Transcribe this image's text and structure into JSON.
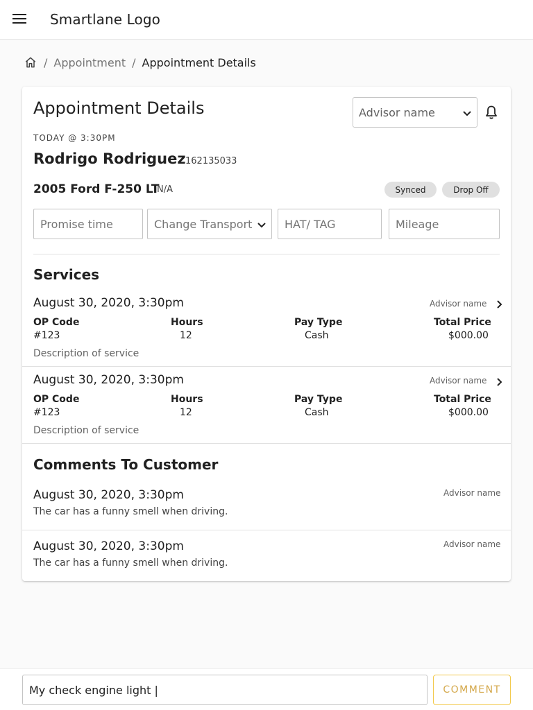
{
  "header": {
    "logo_text": "Smartlane Logo"
  },
  "breadcrumb": {
    "sep1": "/",
    "link": "Appointment",
    "sep2": "/",
    "current": "Appointment Details"
  },
  "details": {
    "title": "Appointment Details",
    "advisor_select": "Advisor name",
    "time_label": "TODAY @ 3:30PM",
    "customer_name": "Rodrigo Rodriguez",
    "customer_id": "162135033",
    "vehicle": "2005 Ford F-250 LT",
    "vehicle_sub": "N/A",
    "chips": {
      "synced": "Synced",
      "drop_off": "Drop Off"
    },
    "fields": {
      "promise": "Promise time",
      "transport": "Change Transport",
      "hat": "HAT/ TAG",
      "mileage": "Mileage"
    }
  },
  "services": {
    "title": "Services",
    "headers": {
      "op": "OP Code",
      "hours": "Hours",
      "pay": "Pay Type",
      "total": "Total Price"
    },
    "items": [
      {
        "date": "August 30, 2020, 3:30pm",
        "advisor": "Advisor name",
        "op_code": "#123",
        "hours": "12",
        "pay_type": "Cash",
        "total": "$000.00",
        "description": "Description of service"
      },
      {
        "date": "August 30, 2020, 3:30pm",
        "advisor": "Advisor name",
        "op_code": "#123",
        "hours": "12",
        "pay_type": "Cash",
        "total": "$000.00",
        "description": "Description of service"
      }
    ]
  },
  "comments": {
    "title": "Comments To Customer",
    "items": [
      {
        "date": "August 30, 2020, 3:30pm",
        "advisor": "Advisor name",
        "text": "The car has a funny smell when driving."
      },
      {
        "date": "August 30, 2020, 3:30pm",
        "advisor": "Advisor name",
        "text": "The car has a funny smell when driving."
      }
    ]
  },
  "composer": {
    "value": "My check engine light |",
    "button": "COMMENT"
  },
  "colors": {
    "accent": "#f2c94c",
    "accent_text": "#d4a84b",
    "chip_bg": "#e0e0e0"
  }
}
